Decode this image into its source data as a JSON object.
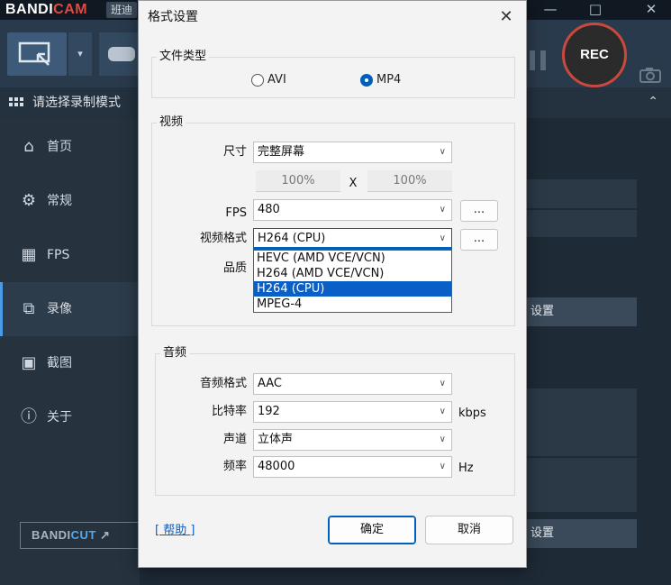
{
  "app": {
    "brand_bandi": "BANDI",
    "brand_cam": "CAM",
    "brand_cn": "班迪",
    "rec_label": "REC",
    "mode_bar_label": "请选择录制模式",
    "sidebar": [
      {
        "label": "首页",
        "icon": "home-icon"
      },
      {
        "label": "常规",
        "icon": "gear-icon"
      },
      {
        "label": "FPS",
        "icon": "fps-icon"
      },
      {
        "label": "录像",
        "icon": "video-icon"
      },
      {
        "label": "截图",
        "icon": "image-icon"
      },
      {
        "label": "关于",
        "icon": "info-icon"
      }
    ],
    "active_sidebar": "录像",
    "bandicut_bandi": "BANDI",
    "bandicut_cut": "CUT",
    "bandicut_arrow": "↗",
    "settings_btn_1": "设置",
    "settings_btn_2": "设置",
    "accent": "#4a9be8",
    "rec_color": "#c9493e"
  },
  "dialog": {
    "title": "格式设置",
    "file_type": {
      "title": "文件类型",
      "options": [
        "AVI",
        "MP4"
      ],
      "selected": "MP4"
    },
    "video": {
      "title": "视频",
      "size_label": "尺寸",
      "size_value": "完整屏幕",
      "width_pct": "100%",
      "x_sep": "X",
      "height_pct": "100%",
      "fps_label": "FPS",
      "fps_value": "480",
      "codec_label": "视频格式",
      "codec_value": "H264 (CPU)",
      "quality_label": "品质",
      "more_btn": "...",
      "codec_options": [
        "HEVC (AMD VCE/VCN)",
        "H264 (AMD VCE/VCN)",
        "H264 (CPU)",
        "MPEG-4"
      ],
      "codec_selected": "H264 (CPU)"
    },
    "audio": {
      "title": "音频",
      "codec_label": "音频格式",
      "codec_value": "AAC",
      "bitrate_label": "比特率",
      "bitrate_value": "192",
      "bitrate_unit": "kbps",
      "channel_label": "声道",
      "channel_value": "立体声",
      "rate_label": "频率",
      "rate_value": "48000",
      "rate_unit": "Hz"
    },
    "help_link": "[ 帮助 ]",
    "ok": "确定",
    "cancel": "取消",
    "close_glyph": "✕",
    "primary_color": "#005fb8"
  }
}
